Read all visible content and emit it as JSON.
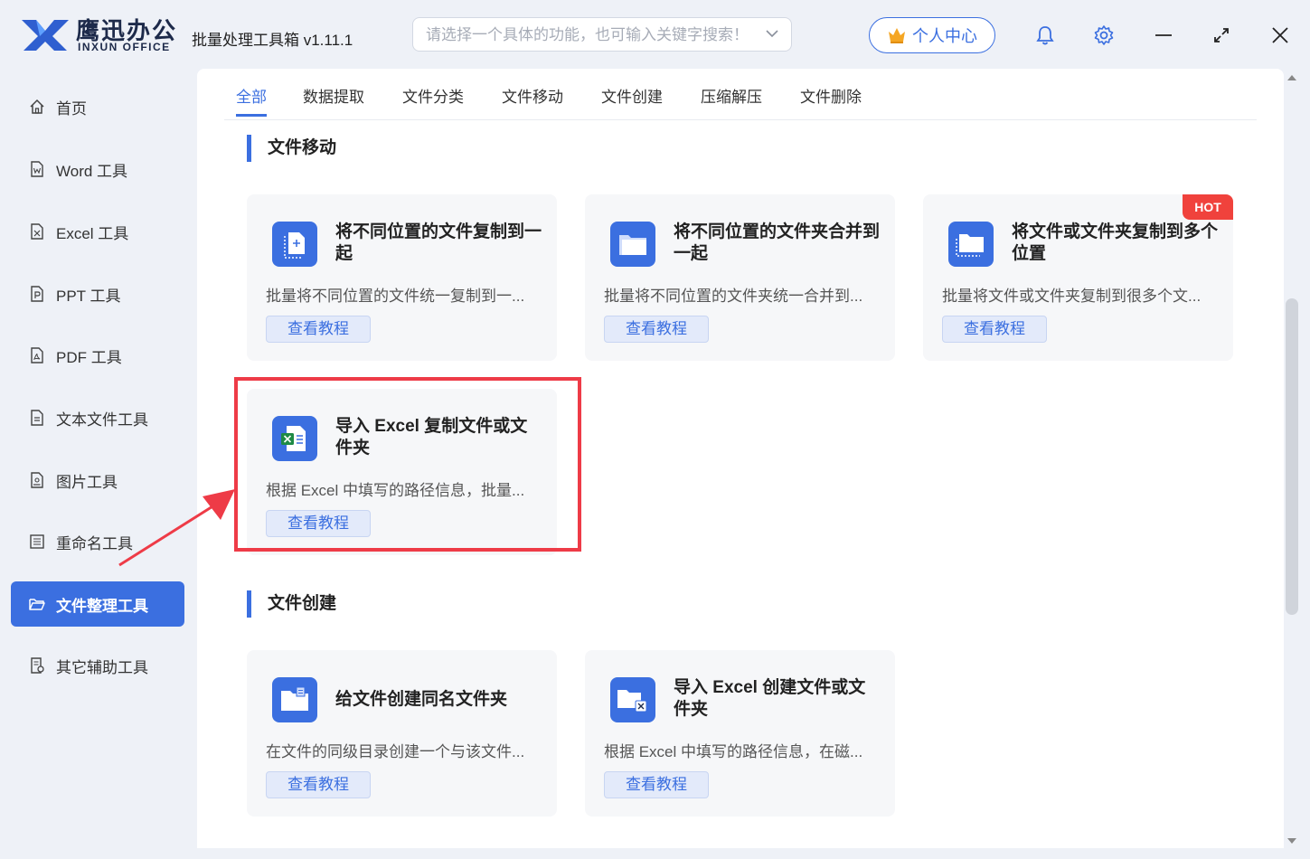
{
  "app": {
    "logo_cn": "鹰迅办公",
    "logo_en": "INXUN OFFICE",
    "title": "批量处理工具箱 v1.11.1"
  },
  "search": {
    "placeholder": "请选择一个具体的功能，也可输入关键字搜索！"
  },
  "header": {
    "user_center_label": "个人中心"
  },
  "colors": {
    "accent": "#3b6fe0",
    "hot": "#f0423c",
    "highlight": "#ee3b47"
  },
  "sidebar": {
    "items": [
      {
        "label": "首页",
        "icon": "home-icon"
      },
      {
        "label": "Word 工具",
        "icon": "word-file-icon"
      },
      {
        "label": "Excel 工具",
        "icon": "excel-file-icon"
      },
      {
        "label": "PPT 工具",
        "icon": "ppt-file-icon"
      },
      {
        "label": "PDF 工具",
        "icon": "pdf-file-icon"
      },
      {
        "label": "文本文件工具",
        "icon": "text-file-icon"
      },
      {
        "label": "图片工具",
        "icon": "image-file-icon"
      },
      {
        "label": "重命名工具",
        "icon": "rename-icon"
      },
      {
        "label": "文件整理工具",
        "icon": "folder-open-icon",
        "active": true
      },
      {
        "label": "其它辅助工具",
        "icon": "tools-icon"
      }
    ]
  },
  "tabs": [
    {
      "label": "全部",
      "active": true
    },
    {
      "label": "数据提取"
    },
    {
      "label": "文件分类"
    },
    {
      "label": "文件移动"
    },
    {
      "label": "文件创建"
    },
    {
      "label": "压缩解压"
    },
    {
      "label": "文件删除"
    }
  ],
  "sections": [
    {
      "title": "文件移动",
      "cards": [
        {
          "title": "将不同位置的文件复制到一起",
          "desc": "批量将不同位置的文件统一复制到一...",
          "button": "查看教程",
          "icon": "file-copy-icon"
        },
        {
          "title": "将不同位置的文件夹合并到一起",
          "desc": "批量将不同位置的文件夹统一合并到...",
          "button": "查看教程",
          "icon": "folder-merge-icon"
        },
        {
          "title": "将文件或文件夹复制到多个位置",
          "desc": "批量将文件或文件夹复制到很多个文...",
          "button": "查看教程",
          "icon": "folder-copy-icon",
          "badge": "HOT"
        },
        {
          "title": "导入 Excel 复制文件或文件夹",
          "desc": "根据 Excel 中填写的路径信息，批量...",
          "button": "查看教程",
          "icon": "excel-import-icon"
        }
      ]
    },
    {
      "title": "文件创建",
      "cards": [
        {
          "title": "给文件创建同名文件夹",
          "desc": "在文件的同级目录创建一个与该文件...",
          "button": "查看教程",
          "icon": "folder-create-icon"
        },
        {
          "title": "导入 Excel 创建文件或文件夹",
          "desc": "根据 Excel 中填写的路径信息，在磁...",
          "button": "查看教程",
          "icon": "excel-folder-icon"
        }
      ]
    }
  ]
}
